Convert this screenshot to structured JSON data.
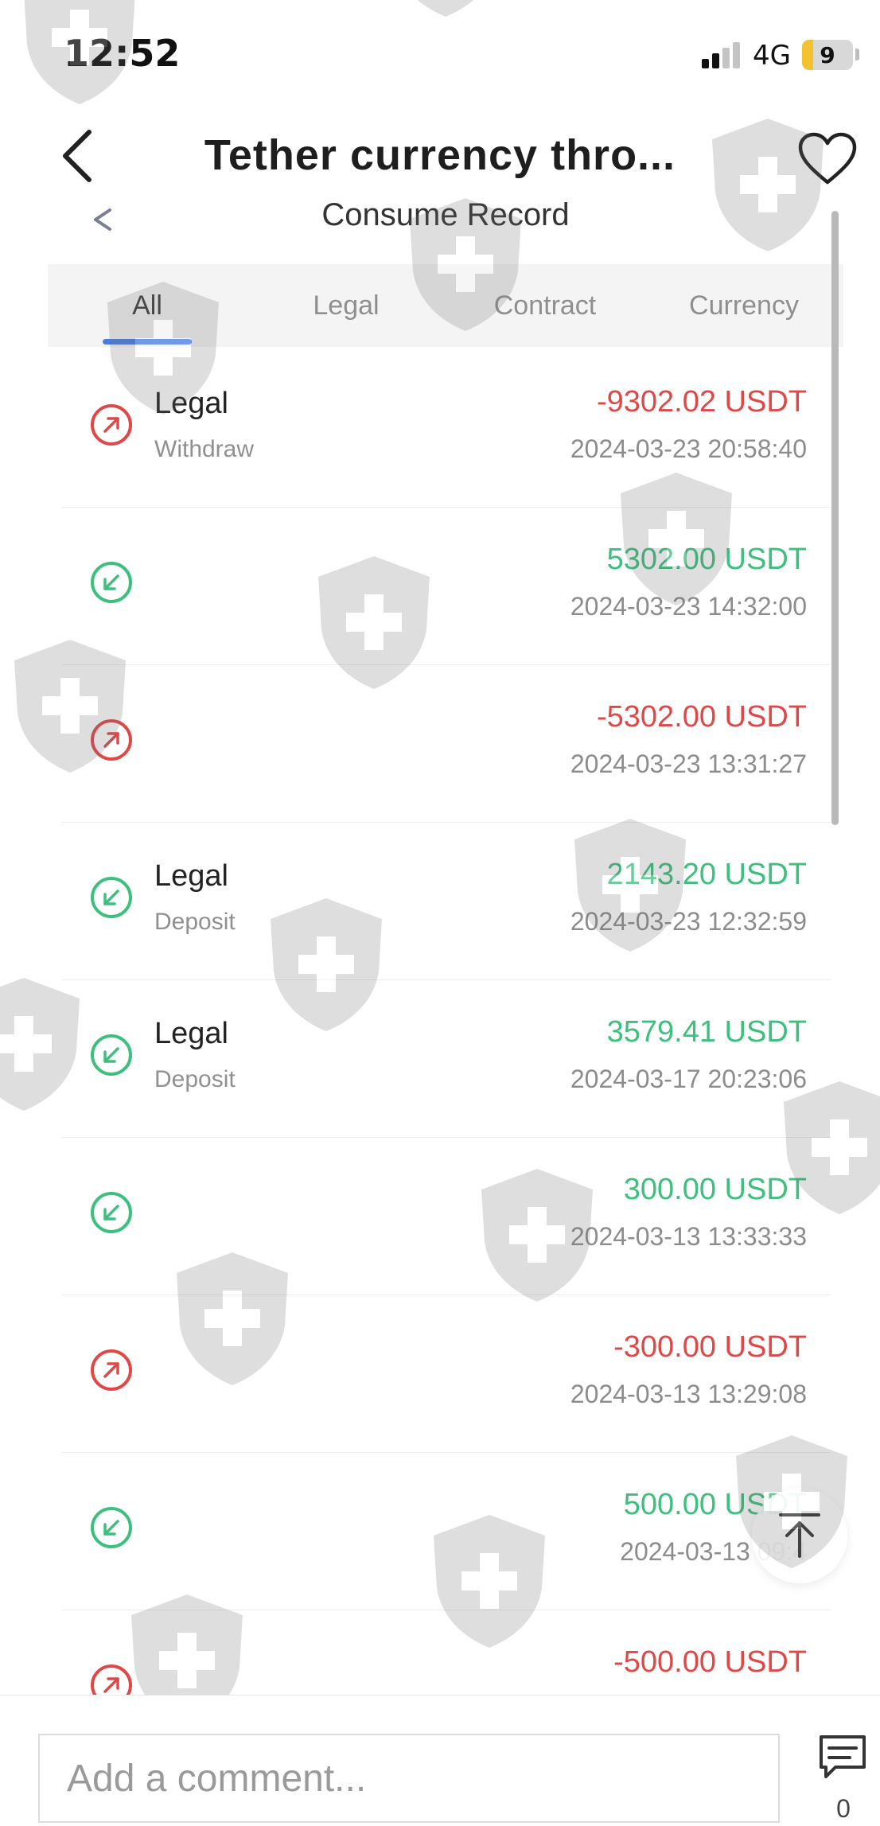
{
  "status_bar": {
    "time": "12:52",
    "network": "4G",
    "battery": "9",
    "battery_color": "#f2c230"
  },
  "nav": {
    "title": "Tether currency thro...",
    "back_icon": "chevron-left-icon",
    "favorite_icon": "heart-icon"
  },
  "page": {
    "title": "Consume Record",
    "back_icon": "chevron-left-icon"
  },
  "tabs": [
    {
      "label": "All",
      "active": true
    },
    {
      "label": "Legal",
      "active": false
    },
    {
      "label": "Contract",
      "active": false
    },
    {
      "label": "Currency",
      "active": false
    }
  ],
  "accent_color": "#4a7de0",
  "records": [
    {
      "direction": "out",
      "icon": "arrow-up-right-icon",
      "title": "Legal",
      "subtitle": "Withdraw",
      "amount": "-9302.02 USDT",
      "time": "2024-03-23 20:58:40"
    },
    {
      "direction": "in",
      "icon": "arrow-down-left-icon",
      "title": "",
      "subtitle": "",
      "amount": "5302.00 USDT",
      "time": "2024-03-23 14:32:00"
    },
    {
      "direction": "out",
      "icon": "arrow-up-right-icon",
      "title": "",
      "subtitle": "",
      "amount": "-5302.00 USDT",
      "time": "2024-03-23 13:31:27"
    },
    {
      "direction": "in",
      "icon": "arrow-down-left-icon",
      "title": "Legal",
      "subtitle": "Deposit",
      "amount": "2143.20 USDT",
      "time": "2024-03-23 12:32:59"
    },
    {
      "direction": "in",
      "icon": "arrow-down-left-icon",
      "title": "Legal",
      "subtitle": "Deposit",
      "amount": "3579.41 USDT",
      "time": "2024-03-17 20:23:06"
    },
    {
      "direction": "in",
      "icon": "arrow-down-left-icon",
      "title": "",
      "subtitle": "",
      "amount": "300.00 USDT",
      "time": "2024-03-13 13:33:33"
    },
    {
      "direction": "out",
      "icon": "arrow-up-right-icon",
      "title": "",
      "subtitle": "",
      "amount": "-300.00 USDT",
      "time": "2024-03-13 13:29:08"
    },
    {
      "direction": "in",
      "icon": "arrow-down-left-icon",
      "title": "",
      "subtitle": "",
      "amount": "500.00 USDT",
      "time": "2024-03-13 09:4"
    },
    {
      "direction": "out",
      "icon": "arrow-up-right-icon",
      "title": "",
      "subtitle": "",
      "amount": "-500.00 USDT",
      "time": ""
    }
  ],
  "colors": {
    "outgoing": "#e04848",
    "incoming": "#3dbf7e"
  },
  "scroll_to_top_icon": "arrow-up-to-line-icon",
  "watermark_icon": "shield-plus-icon",
  "comment_bar": {
    "placeholder": "Add a comment...",
    "comment_icon": "comment-icon",
    "comment_count": "0"
  }
}
